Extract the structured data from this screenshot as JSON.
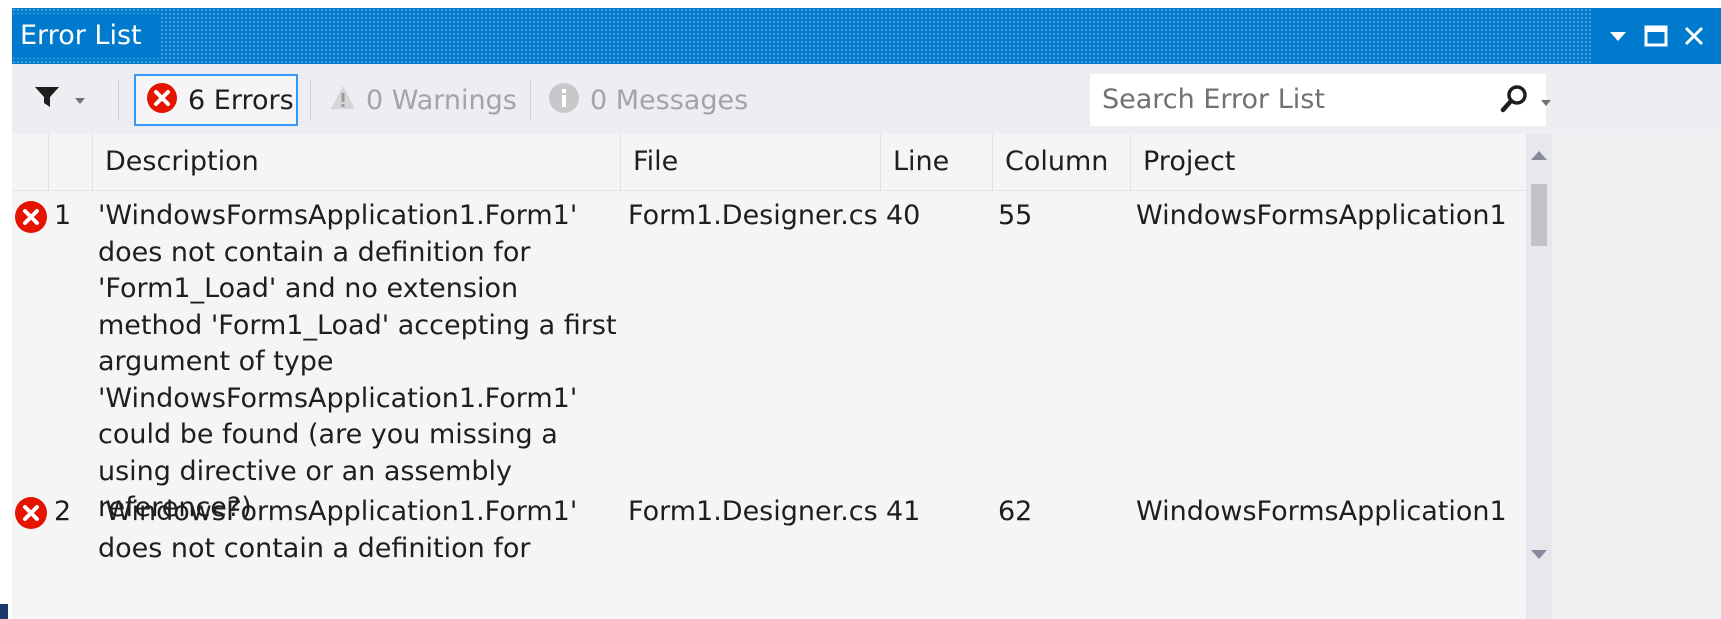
{
  "window": {
    "title": "Error List"
  },
  "toolbar": {
    "errors_label": "6 Errors",
    "warnings_label": "0 Warnings",
    "messages_label": "0 Messages",
    "search_placeholder": "Search Error List"
  },
  "columns": [
    "Description",
    "File",
    "Line",
    "Column",
    "Project"
  ],
  "rows": [
    {
      "index": "1",
      "description": "'WindowsFormsApplication1.Form1' does not contain a definition for 'Form1_Load' and no extension method 'Form1_Load' accepting a first argument of type 'WindowsFormsApplication1.Form1' could be found (are you missing a using directive or an assembly reference?)",
      "file": "Form1.Designer.cs",
      "line": "40",
      "column": "55",
      "project": "WindowsFormsApplication1"
    },
    {
      "index": "2",
      "description": "'WindowsFormsApplication1.Form1' does not contain a definition for",
      "file": "Form1.Designer.cs",
      "line": "41",
      "column": "62",
      "project": "WindowsFormsApplication1"
    }
  ],
  "colors": {
    "titlebar": "#007acc",
    "error_red": "#e51400",
    "selected_border": "#3399ff"
  },
  "icons": {
    "filter": "filter-icon",
    "error": "error-icon",
    "warning": "warning-icon",
    "info": "info-icon",
    "search": "search-icon"
  }
}
